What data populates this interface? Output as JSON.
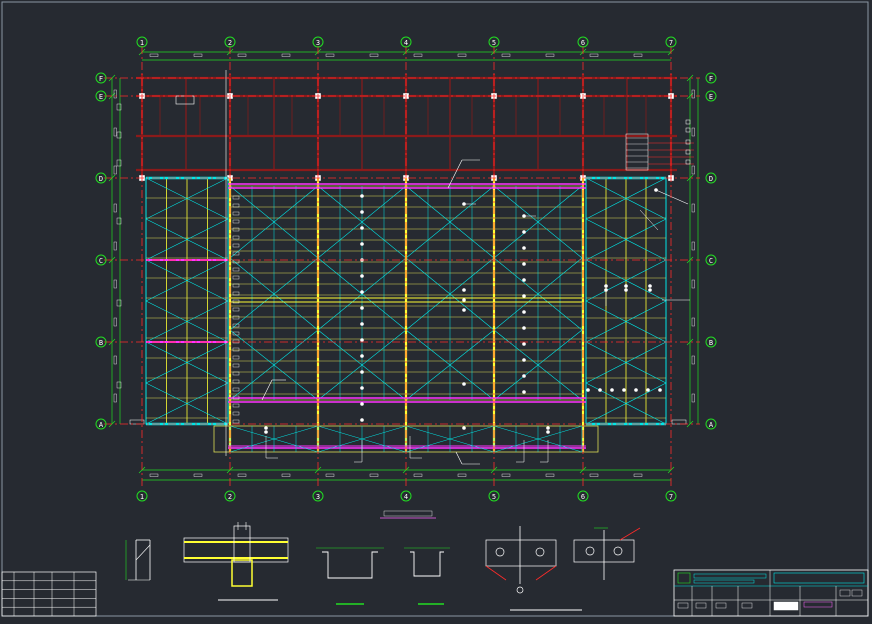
{
  "drawing": {
    "grid_columns": [
      "1",
      "2",
      "3",
      "4",
      "5",
      "6",
      "7"
    ],
    "grid_rows": [
      "F",
      "E",
      "D",
      "C",
      "B",
      "A"
    ],
    "colors": {
      "background": "#262a31",
      "frame": "#8a96a3",
      "axis_line": "#ff2a2a",
      "dimension": "#22dd22",
      "steel_beam": "#8b1a1a",
      "purlin": "#00e6e6",
      "main_beam": "#ffff33",
      "secondary": "#dddd55",
      "brace": "#ff33ff",
      "annotation": "#ffffff",
      "title_text": "#ff66ff"
    },
    "icons": [
      "axis-bubble-icon",
      "leader-dot-icon"
    ]
  }
}
